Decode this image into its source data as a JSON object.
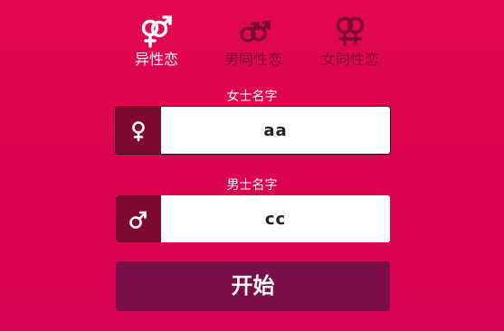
{
  "tabs": [
    {
      "label": "异性恋",
      "icon": "male-female-icon",
      "active": true
    },
    {
      "label": "男同性恋",
      "icon": "male-male-icon",
      "active": false
    },
    {
      "label": "女同性恋",
      "icon": "female-female-icon",
      "active": false
    }
  ],
  "female_field": {
    "caption": "女士名字",
    "icon": "female-symbol-icon",
    "value": "aa"
  },
  "male_field": {
    "caption": "男士名字",
    "icon": "male-symbol-icon",
    "value": "cc"
  },
  "start_button": {
    "label": "开始"
  },
  "colors": {
    "background": "#db0350",
    "addon": "#7d0a2e",
    "button": "#7a0f47",
    "active_text": "#ffffff",
    "inactive_text": "#7a0b2e"
  }
}
